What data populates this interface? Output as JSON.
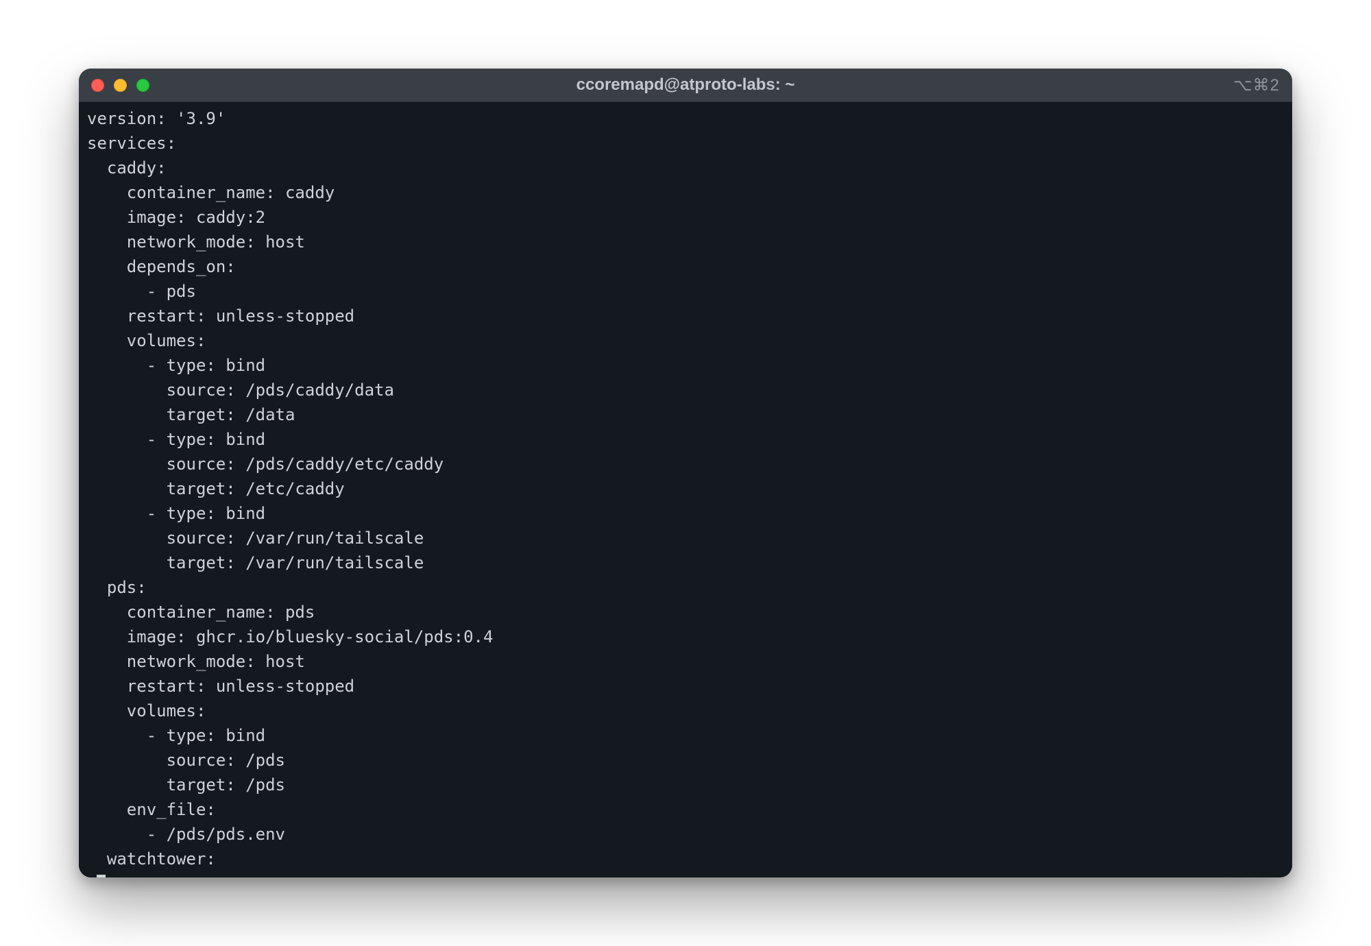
{
  "window": {
    "title": "ccoremapd@atproto-labs: ~",
    "shortcut": "⌥⌘2"
  },
  "pager": {
    "prompt": ":"
  },
  "file": {
    "lines": [
      "version: '3.9'",
      "services:",
      "  caddy:",
      "    container_name: caddy",
      "    image: caddy:2",
      "    network_mode: host",
      "    depends_on:",
      "      - pds",
      "    restart: unless-stopped",
      "    volumes:",
      "      - type: bind",
      "        source: /pds/caddy/data",
      "        target: /data",
      "      - type: bind",
      "        source: /pds/caddy/etc/caddy",
      "        target: /etc/caddy",
      "      - type: bind",
      "        source: /var/run/tailscale",
      "        target: /var/run/tailscale",
      "  pds:",
      "    container_name: pds",
      "    image: ghcr.io/bluesky-social/pds:0.4",
      "    network_mode: host",
      "    restart: unless-stopped",
      "    volumes:",
      "      - type: bind",
      "        source: /pds",
      "        target: /pds",
      "    env_file:",
      "      - /pds/pds.env",
      "  watchtower:"
    ]
  }
}
